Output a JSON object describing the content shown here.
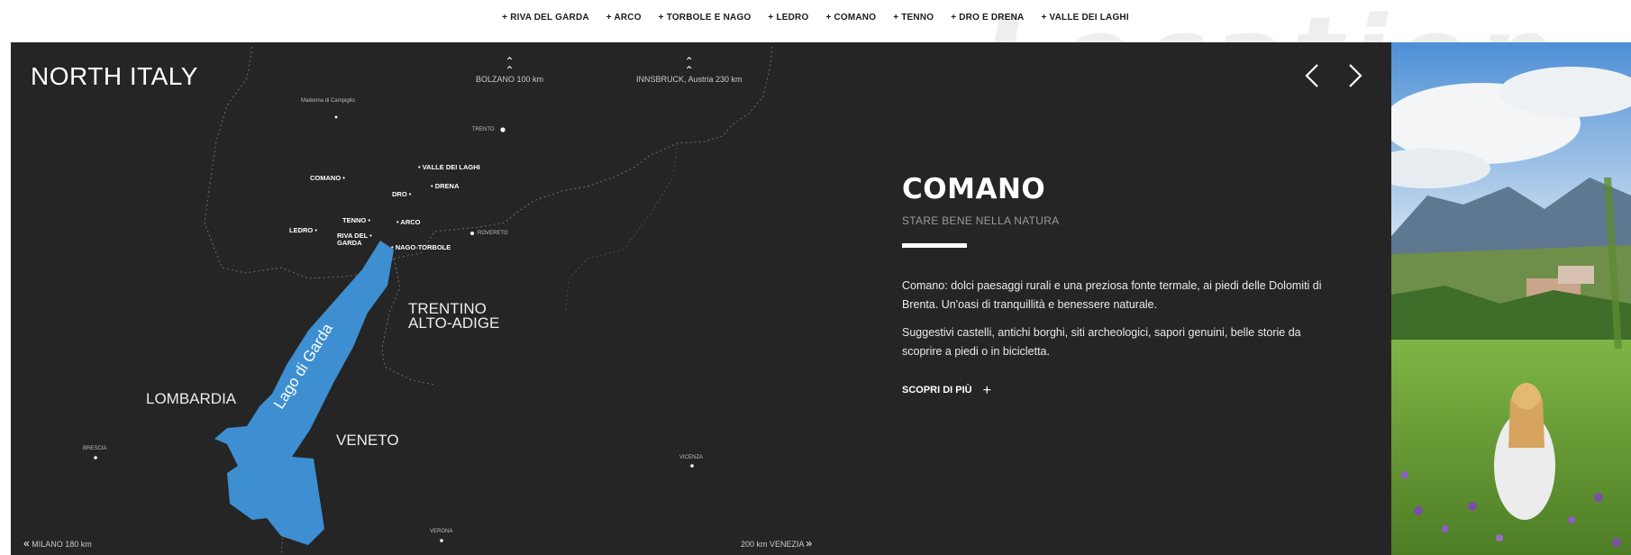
{
  "nav": {
    "items": [
      "+ RIVA DEL GARDA",
      "+ ARCO",
      "+ TORBOLE E NAGO",
      "+ LEDRO",
      "+ COMANO",
      "+ TENNO",
      "+ DRO E DRENA",
      "+ VALLE DEI LAGHI"
    ]
  },
  "map": {
    "title": "NORTH ITALY",
    "north_left": "BOLZANO 100 km",
    "north_right": "INNSBRUCK, Austria 230 km",
    "west": "MILANO 180 km",
    "east": "200 km VENEZIA",
    "lake": "Lago di Garda",
    "regions": {
      "lombardia": "LOMBARDIA",
      "veneto": "VENETO",
      "trentino_1": "TRENTINO",
      "trentino_2": "ALTO-ADIGE"
    },
    "cities": {
      "madonna": "Madonna di Campiglio",
      "trento": "TRENTO",
      "rovereto": "ROVERETO",
      "brescia": "BRESCIA",
      "vicenza": "VICENZA",
      "verona": "VERONA"
    },
    "towns": {
      "valle": "• VALLE DEI LAGHI",
      "drena": "• DRENA",
      "comano": "COMANO •",
      "dro": "DRO •",
      "tenno": "TENNO •",
      "arco": "• ARCO",
      "ledro": "LEDRO •",
      "riva_1": "RIVA DEL •",
      "riva_2": "GARDA",
      "nago": "• NAGO-TORBOLE"
    }
  },
  "panel": {
    "title": "COMANO",
    "subtitle": "STARE BENE NELLA NATURA",
    "p1": "Comano: dolci paesaggi rurali e una preziosa fonte termale, ai piedi delle Dolomiti di Brenta. Un'oasi di tranquillità e benessere naturale.",
    "p2": "Suggestivi castelli, antichi borghi, siti archeologici, sapori genuini, belle storie da scoprire a piedi o in bicicletta.",
    "more": "SCOPRI DI PIÙ"
  },
  "colors": {
    "stage_bg": "#252525",
    "lake": "#3d8fd1",
    "accent_white": "#ffffff"
  },
  "watermark": "Location"
}
